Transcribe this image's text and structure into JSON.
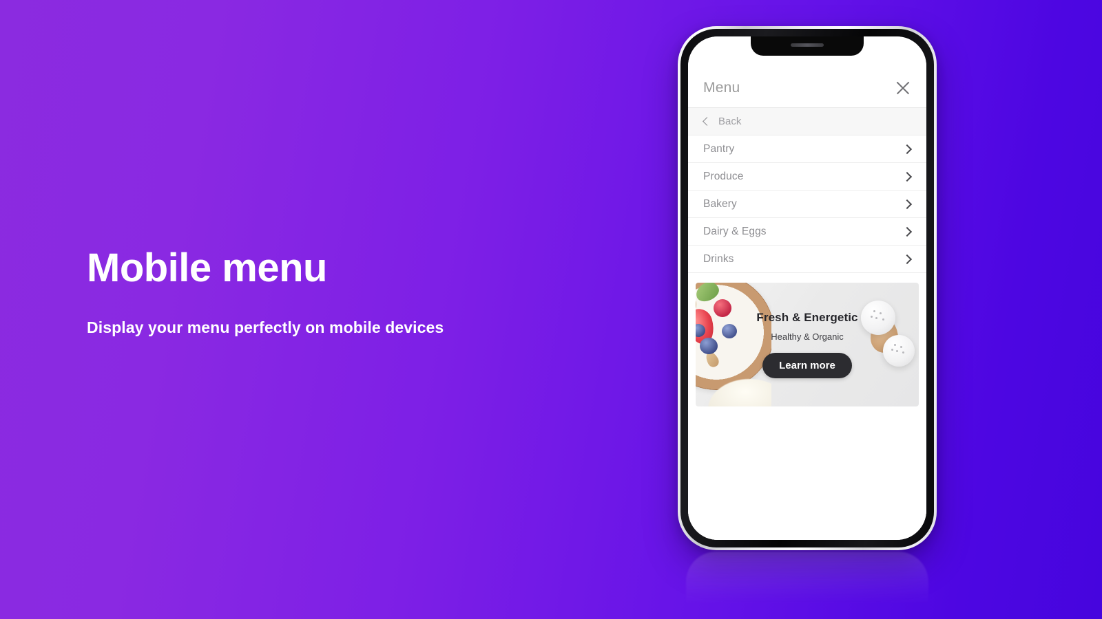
{
  "background": {
    "gradient_start": "#8b2be0",
    "gradient_end": "#4605de"
  },
  "hero": {
    "headline": "Mobile menu",
    "subhead": "Display your menu perfectly on mobile devices"
  },
  "phone": {
    "notch_icon": "speaker-grille"
  },
  "app": {
    "header": {
      "title": "Menu",
      "close_icon": "close-icon"
    },
    "back": {
      "label": "Back",
      "icon": "chevron-left-icon"
    },
    "menu_items": [
      {
        "label": "Pantry",
        "icon": "chevron-right-icon"
      },
      {
        "label": "Produce",
        "icon": "chevron-right-icon"
      },
      {
        "label": "Bakery",
        "icon": "chevron-right-icon"
      },
      {
        "label": "Dairy & Eggs",
        "icon": "chevron-right-icon"
      },
      {
        "label": "Drinks",
        "icon": "chevron-right-icon"
      }
    ],
    "promo": {
      "title": "Fresh & Energetic",
      "subtitle": "Healthy & Organic",
      "button_label": "Learn more",
      "button_color": "#2c2c30"
    }
  }
}
